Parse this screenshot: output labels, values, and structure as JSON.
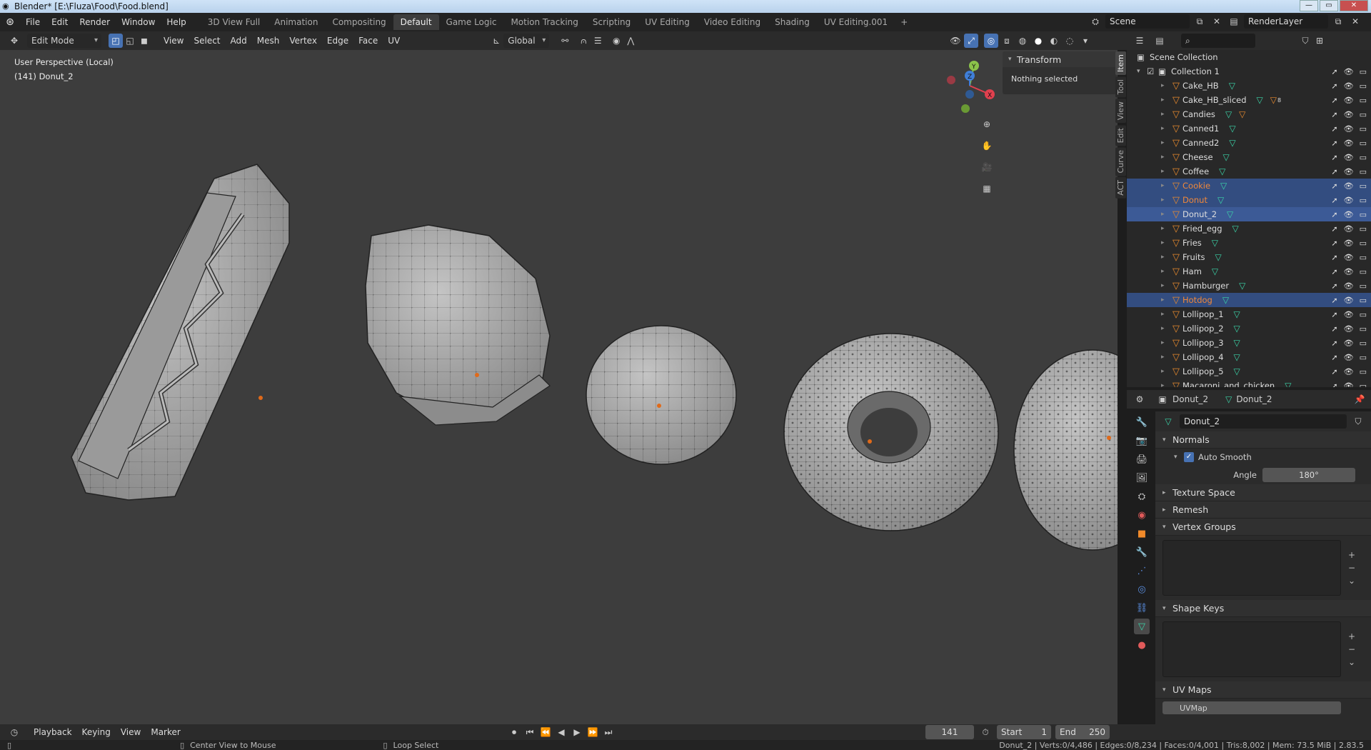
{
  "window": {
    "title": "Blender* [E:\\Fluza\\Food\\Food.blend]"
  },
  "topbar": {
    "menus": [
      "File",
      "Edit",
      "Render",
      "Window",
      "Help"
    ],
    "workspaces": [
      "3D View Full",
      "Animation",
      "Compositing",
      "Default",
      "Game Logic",
      "Motion Tracking",
      "Scripting",
      "UV Editing",
      "Video Editing",
      "Shading",
      "UV Editing.001"
    ],
    "active_workspace": "Default",
    "scene": "Scene",
    "render_layer": "RenderLayer"
  },
  "viewport_header": {
    "mode": "Edit Mode",
    "menus": [
      "View",
      "Select",
      "Add",
      "Mesh",
      "Vertex",
      "Edge",
      "Face",
      "UV"
    ],
    "orientation": "Global"
  },
  "viewport": {
    "perspective": "User Perspective (Local)",
    "object_info": "(141) Donut_2",
    "gizmo": {
      "x": "X",
      "y": "Y",
      "z": "Z"
    }
  },
  "npanel": {
    "tabs": [
      "Item",
      "Tool",
      "View",
      "Edit",
      "Curve",
      "ACT"
    ],
    "active_tab": "Item",
    "section": "Transform",
    "message": "Nothing selected"
  },
  "outliner": {
    "root": "Scene Collection",
    "collection": "Collection 1",
    "modifier_count": "8",
    "items": [
      {
        "name": "Cake_HB",
        "state": ""
      },
      {
        "name": "Cake_HB_sliced",
        "state": "",
        "has_modifier": true
      },
      {
        "name": "Candies",
        "state": "",
        "has_modifier": true
      },
      {
        "name": "Canned1",
        "state": ""
      },
      {
        "name": "Canned2",
        "state": ""
      },
      {
        "name": "Cheese",
        "state": ""
      },
      {
        "name": "Coffee",
        "state": ""
      },
      {
        "name": "Cookie",
        "state": "sel"
      },
      {
        "name": "Donut",
        "state": "sel"
      },
      {
        "name": "Donut_2",
        "state": "active"
      },
      {
        "name": "Fried_egg",
        "state": ""
      },
      {
        "name": "Fries",
        "state": ""
      },
      {
        "name": "Fruits",
        "state": ""
      },
      {
        "name": "Ham",
        "state": ""
      },
      {
        "name": "Hamburger",
        "state": ""
      },
      {
        "name": "Hotdog",
        "state": "sel"
      },
      {
        "name": "Lollipop_1",
        "state": ""
      },
      {
        "name": "Lollipop_2",
        "state": ""
      },
      {
        "name": "Lollipop_3",
        "state": ""
      },
      {
        "name": "Lollipop_4",
        "state": ""
      },
      {
        "name": "Lollipop_5",
        "state": ""
      },
      {
        "name": "Macaroni_and_chicken",
        "state": ""
      }
    ]
  },
  "properties": {
    "breadcrumb_object": "Donut_2",
    "breadcrumb_data": "Donut_2",
    "data_name": "Donut_2",
    "normals": "Normals",
    "auto_smooth": "Auto Smooth",
    "angle_label": "Angle",
    "angle_value": "180°",
    "texture_space": "Texture Space",
    "remesh": "Remesh",
    "vertex_groups": "Vertex Groups",
    "shape_keys": "Shape Keys",
    "uv_maps": "UV Maps",
    "uv_map_item": "UVMap"
  },
  "timeline": {
    "menus": [
      "Playback",
      "Keying",
      "View",
      "Marker"
    ],
    "current_frame": "141",
    "start_label": "Start",
    "start": "1",
    "end_label": "End",
    "end": "250"
  },
  "statusbar": {
    "hint1": "Center View to Mouse",
    "hint2": "Loop Select",
    "stats": "Donut_2 | Verts:0/4,486 | Edges:0/8,234 | Faces:0/4,001 | Tris:8,002 | Mem: 73.5 MiB | 2.83.5"
  }
}
